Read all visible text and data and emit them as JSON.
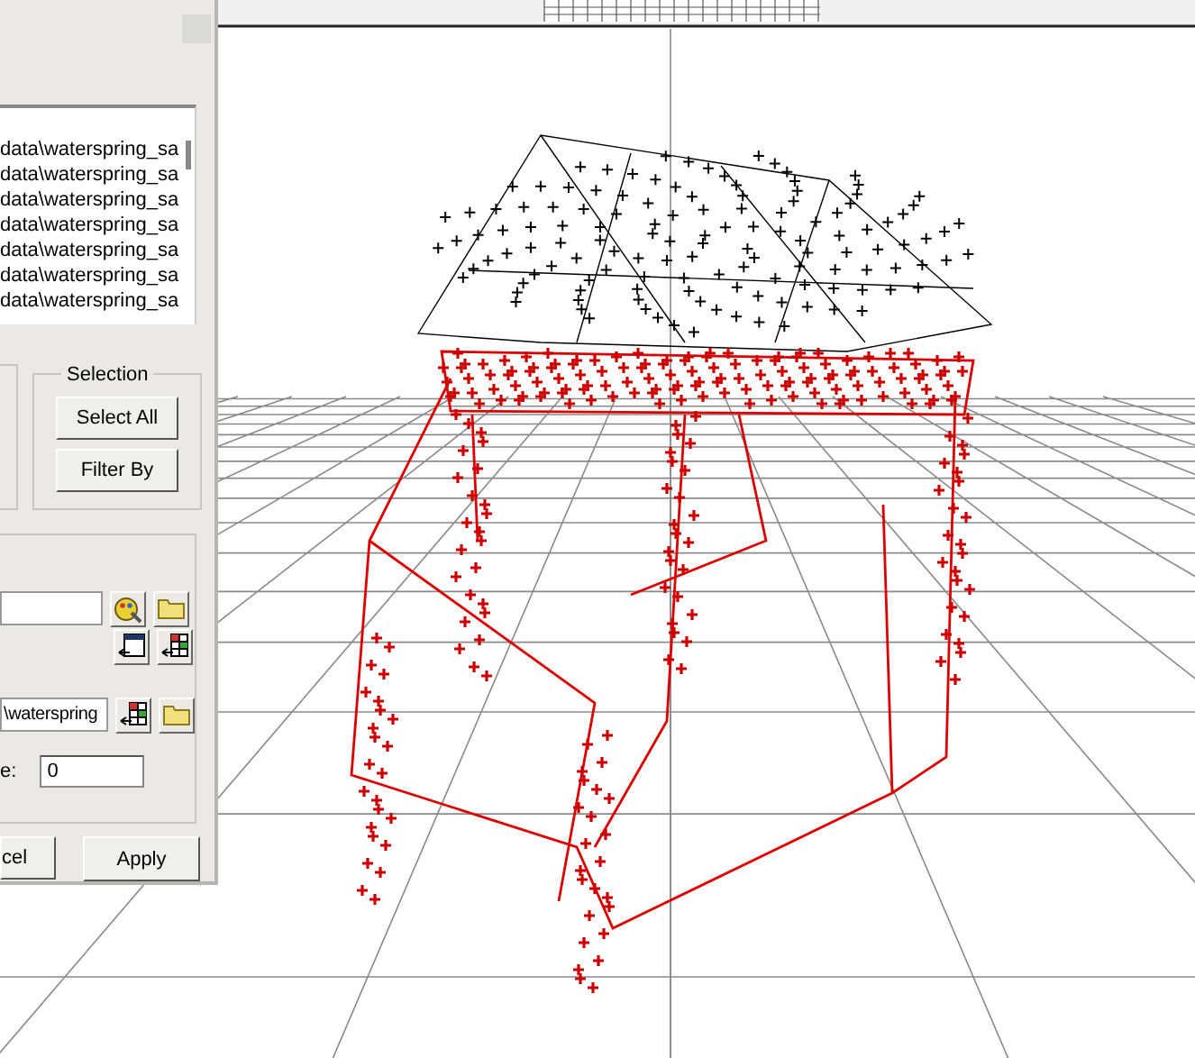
{
  "list": {
    "items": [
      "data\\waterspring_sa",
      "data\\waterspring_sa",
      "data\\waterspring_sa",
      "data\\waterspring_sa",
      "data\\waterspring_sa",
      "data\\waterspring_sa",
      "data\\waterspring_sa"
    ]
  },
  "selection": {
    "title": "Selection",
    "buttons": [
      "Select All",
      "Filter By"
    ]
  },
  "path_field": {
    "value": "\\waterspring"
  },
  "number_field": {
    "label": "e:",
    "value": "0"
  },
  "buttons": [
    "cel",
    "Apply"
  ]
}
